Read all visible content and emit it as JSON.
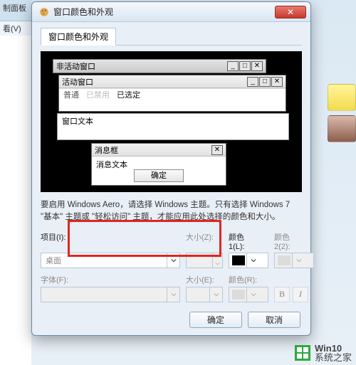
{
  "background": {
    "panel_text_top": "制面板",
    "panel_text_menu": "看(V)"
  },
  "dialog": {
    "title": "窗口颜色和外观",
    "tab_label": "窗口颜色和外观"
  },
  "preview": {
    "inactive_title": "非活动窗口",
    "active_title": "活动窗口",
    "subbar_normal": "普通",
    "subbar_disabled": "已禁用",
    "subbar_selected": "已选定",
    "window_text": "窗口文本",
    "message_box_title": "消息框",
    "message_text": "消息文本",
    "ok": "确定"
  },
  "hint": "要启用 Windows Aero，请选择 Windows 主题。只有选择 Windows 7 \"基本\" 主题或 \"轻松访问\" 主题，才能应用此处选择的颜色和大小。",
  "form": {
    "item_label": "项目(I):",
    "size_label": "大小(Z):",
    "color1_label": "颜色\n1(L):",
    "color2_label": "颜色\n2(2):",
    "item_value": "桌面",
    "font_label": "字体(F):",
    "fsize_label": "大小(E):",
    "fcolor_label": "颜色(R):",
    "bold": "B",
    "italic": "I"
  },
  "footer": {
    "ok": "确定",
    "cancel": "取消"
  },
  "watermark": {
    "line1": "Win10",
    "line2": "系统之家"
  }
}
